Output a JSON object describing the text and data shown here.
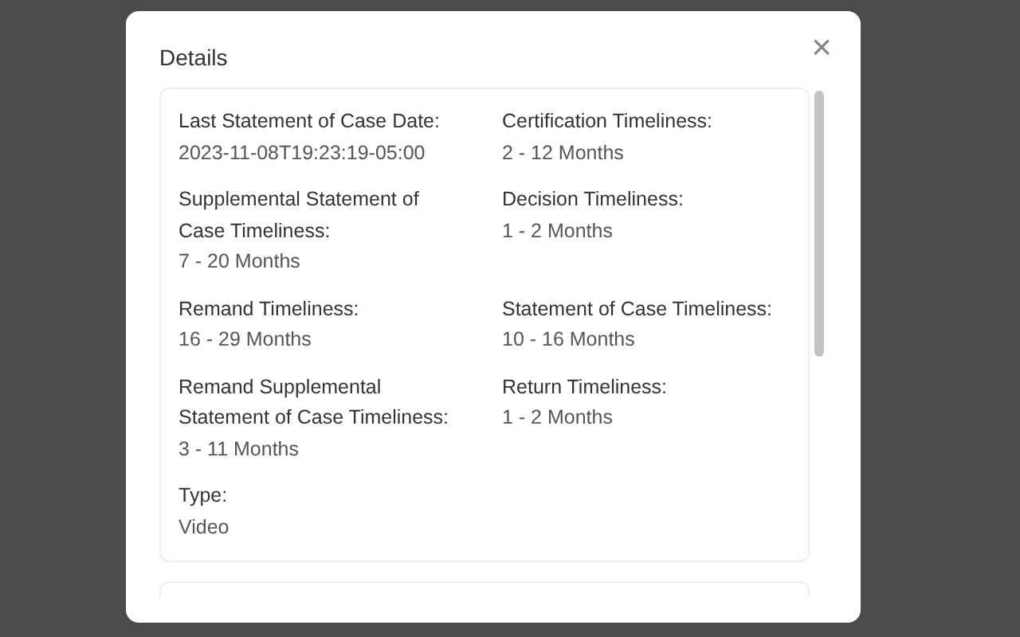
{
  "dialog": {
    "title": "Details",
    "close": "×"
  },
  "fields": [
    {
      "label": "Last Statement of Case Date:",
      "value": "2023-11-08T19:23:19-05:00"
    },
    {
      "label": "Certification Timeliness:",
      "value": "2 - 12 Months"
    },
    {
      "label": "Supplemental Statement of Case Timeliness:",
      "value": "7 - 20 Months"
    },
    {
      "label": "Decision Timeliness:",
      "value": "1 - 2 Months"
    },
    {
      "label": "Remand Timeliness:",
      "value": "16 - 29 Months"
    },
    {
      "label": "Statement of Case Timeliness:",
      "value": "10 - 16 Months"
    },
    {
      "label": "Remand Supplemental Statement of Case Timeliness:",
      "value": "3 - 11 Months"
    },
    {
      "label": "Return Timeliness:",
      "value": "1 - 2 Months"
    },
    {
      "label": "Type:",
      "value": "Video"
    }
  ]
}
